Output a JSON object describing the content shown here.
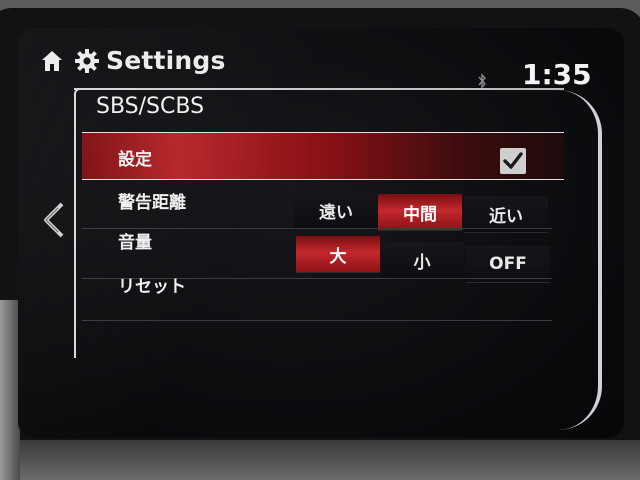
{
  "header": {
    "title": "Settings",
    "clock": "1:35",
    "icons": [
      "home-icon",
      "gear-icon",
      "bluetooth-icon"
    ]
  },
  "section": {
    "title": "SBS/SCBS"
  },
  "rows": {
    "setting": {
      "label": "設定",
      "checked": true
    },
    "distance": {
      "label": "警告距離",
      "options": [
        "遠い",
        "中間",
        "近い"
      ],
      "selected": "中間"
    },
    "volume": {
      "label": "音量",
      "options": [
        "大",
        "小",
        "OFF"
      ],
      "selected": "大"
    },
    "reset": {
      "label": "リセット"
    }
  },
  "colors": {
    "accent": "#b6262a",
    "text": "#f0f0f0",
    "background": "#0b0b0e"
  }
}
